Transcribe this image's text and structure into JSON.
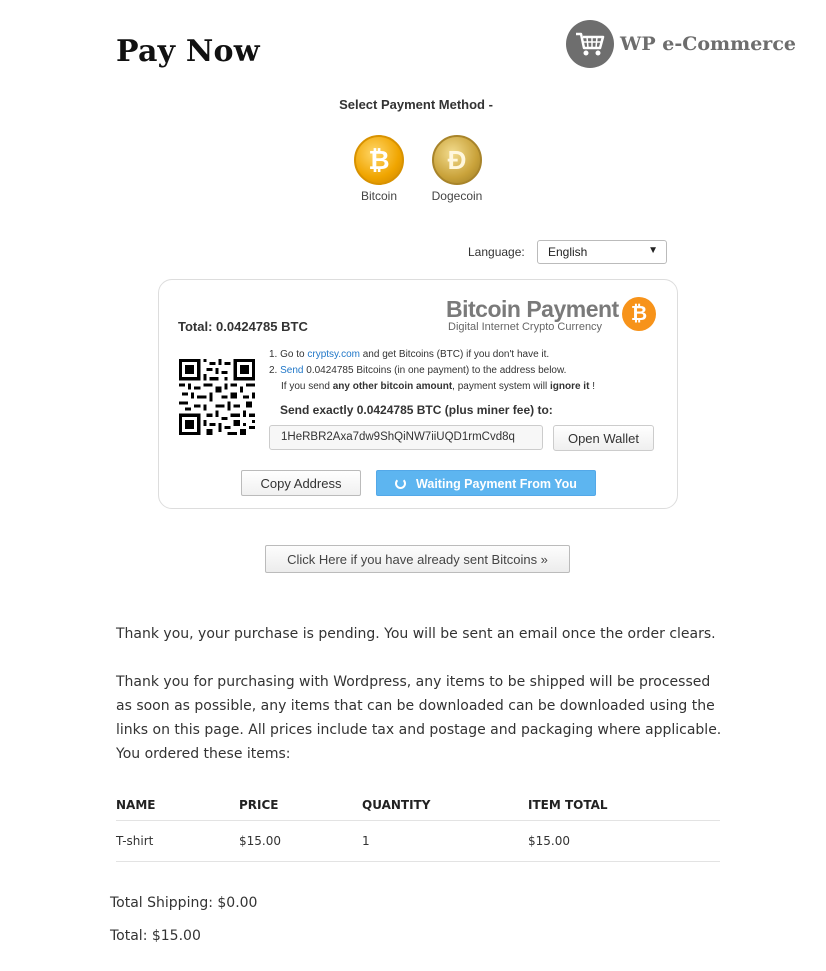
{
  "header": {
    "title": "Pay Now",
    "brand": "WP e-Commerce"
  },
  "payment_method": {
    "label": "Select Payment Method -",
    "options": [
      {
        "label": "Bitcoin",
        "icon": "bitcoin-coin-icon"
      },
      {
        "label": "Dogecoin",
        "icon": "dogecoin-coin-icon"
      }
    ]
  },
  "language": {
    "label": "Language:",
    "selected": "English"
  },
  "bitcoin_box": {
    "title": "Bitcoin Payment",
    "subtitle": "Digital Internet Crypto Currency",
    "total_label": "Total:",
    "total_value": "0.0424785",
    "total_unit": "BTC",
    "step1_prefix": "1. Go to",
    "step1_link": "cryptsy.com",
    "step1_suffix": "and get Bitcoins (BTC) if you don't have it.",
    "step2_prefix": "2.",
    "step2_link": "Send",
    "step2_suffix": "0.0424785 Bitcoins (in one payment) to the address below.",
    "step2_warn_a": "If you send",
    "step2_warn_b": "any other bitcoin amount",
    "step2_warn_c": ", payment system will",
    "step2_warn_d": "ignore it",
    "step2_warn_e": "!",
    "send_exact": "Send exactly 0.0424785 BTC (plus miner fee) to:",
    "address": "1HeRBR2Axa7dw9ShQiNW7iiUQD1rmCvd8q",
    "open_wallet": "Open Wallet",
    "copy_address": "Copy Address",
    "waiting": "Waiting Payment From You"
  },
  "sent_button": "Click Here if you have already sent Bitcoins »",
  "messages": {
    "pending": "Thank you, your purchase is pending. You will be sent an email once the order clears.",
    "thanks": "Thank you for purchasing with Wordpress, any items to be shipped will be processed as soon as possible, any items that can be downloaded can be downloaded using the links on this page. All prices include tax and postage and packaging where applicable.",
    "ordered": "You ordered these items:"
  },
  "order_table": {
    "columns": [
      "NAME",
      "PRICE",
      "QUANTITY",
      "ITEM TOTAL"
    ],
    "rows": [
      [
        "T-shirt",
        "$15.00",
        "1",
        "$15.00"
      ]
    ]
  },
  "totals": {
    "shipping": "Total Shipping: $0.00",
    "total": "Total: $15.00"
  },
  "colors": {
    "bitcoin_orange": "#f7931a",
    "waiting_blue": "#5db5f0",
    "link_blue": "#2278c8"
  }
}
